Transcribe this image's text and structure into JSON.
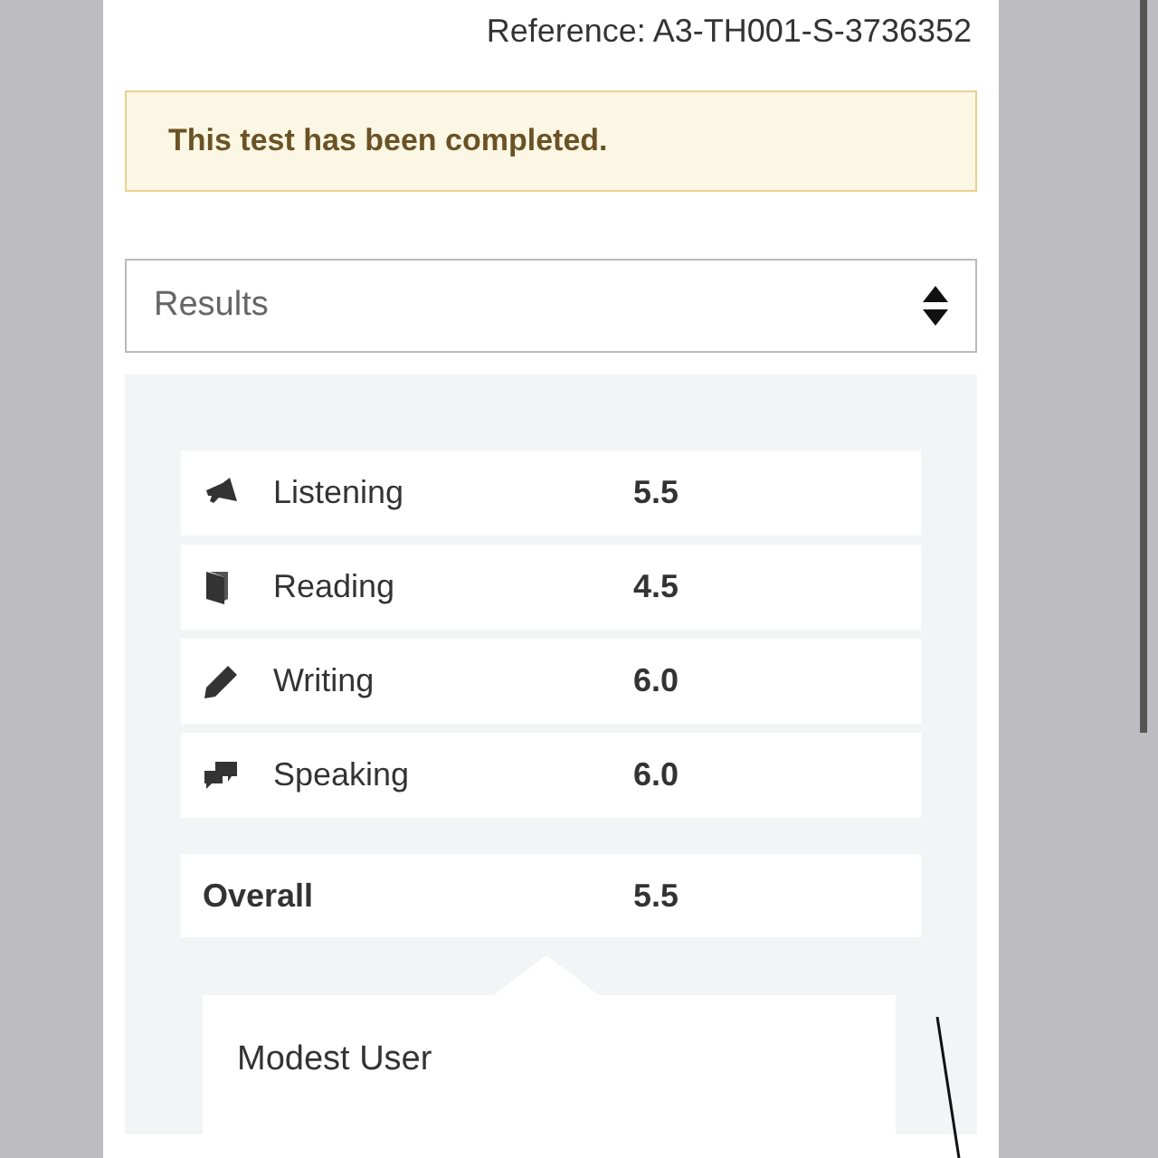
{
  "reference": "Reference: A3-TH001-S-3736352",
  "alert": "This test has been completed.",
  "select": {
    "value": "Results"
  },
  "skills": [
    {
      "kind": "listening",
      "name": "Listening",
      "score": "5.5"
    },
    {
      "kind": "reading",
      "name": "Reading",
      "score": "4.5"
    },
    {
      "kind": "writing",
      "name": "Writing",
      "score": "6.0"
    },
    {
      "kind": "speaking",
      "name": "Speaking",
      "score": "6.0"
    }
  ],
  "overall": {
    "label": "Overall",
    "score": "5.5"
  },
  "band": {
    "title": "Modest User"
  }
}
